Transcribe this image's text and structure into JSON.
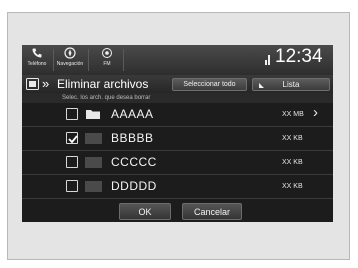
{
  "status_bar": {
    "phone_label": "Teléfono",
    "nav_label": "Navegación",
    "radio_label": "FM",
    "clock": "12:34"
  },
  "header": {
    "title": "Eliminar archivos",
    "select_all_label": "Seleccionar todo",
    "list_label": "Lista"
  },
  "instruction": "Selec. los arch. que desea borrar",
  "rows": [
    {
      "name": "AAAAA",
      "size": "XX MB",
      "checked": false,
      "kind": "folder"
    },
    {
      "name": "BBBBB",
      "size": "XX KB",
      "checked": true,
      "kind": "file"
    },
    {
      "name": "CCCCC",
      "size": "XX KB",
      "checked": false,
      "kind": "file"
    },
    {
      "name": "DDDDD",
      "size": "XX KB",
      "checked": false,
      "kind": "file"
    }
  ],
  "buttons": {
    "ok_label": "OK",
    "cancel_label": "Cancelar"
  },
  "icons": {
    "phone": "phone-icon",
    "navigation": "compass-icon",
    "radio": "radio-icon",
    "signal": "signal-icon",
    "header": "file-manager-icon",
    "folder": "folder-icon",
    "checkmark": "checkmark-icon",
    "next": "chevron-right-icon"
  }
}
